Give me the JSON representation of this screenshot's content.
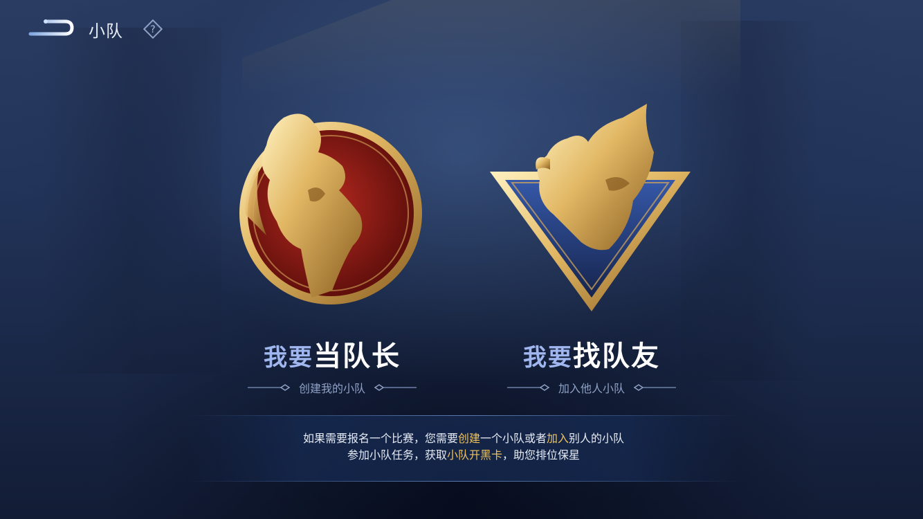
{
  "header": {
    "title": "小队",
    "back_icon": "back-arrow-icon",
    "help_icon": "question-mark-icon",
    "help_label": "?"
  },
  "cards": {
    "captain": {
      "title_prefix": "我要",
      "title_main": "当队长",
      "subtitle": "创建我的小队",
      "emblem_icon": "captain-emblem-icon"
    },
    "member": {
      "title_prefix": "我要",
      "title_main": "找队友",
      "subtitle": "加入他人小队",
      "emblem_icon": "teammate-emblem-icon"
    }
  },
  "info": {
    "line1": {
      "part1": "如果需要报名一个比赛，您需要",
      "hl1": "创建",
      "part2": "一个小队或者",
      "hl2": "加入",
      "part3": "别人的小队"
    },
    "line2": {
      "part1": "参加小队任务，获取",
      "hl1": "小队开黑卡",
      "part2": "，助您排位保星"
    }
  },
  "colors": {
    "accent_gold": "#f0c35a",
    "label_blue": "#9fb6ee",
    "sub_text": "#8fa2c6",
    "background": "#1c2b4c"
  }
}
